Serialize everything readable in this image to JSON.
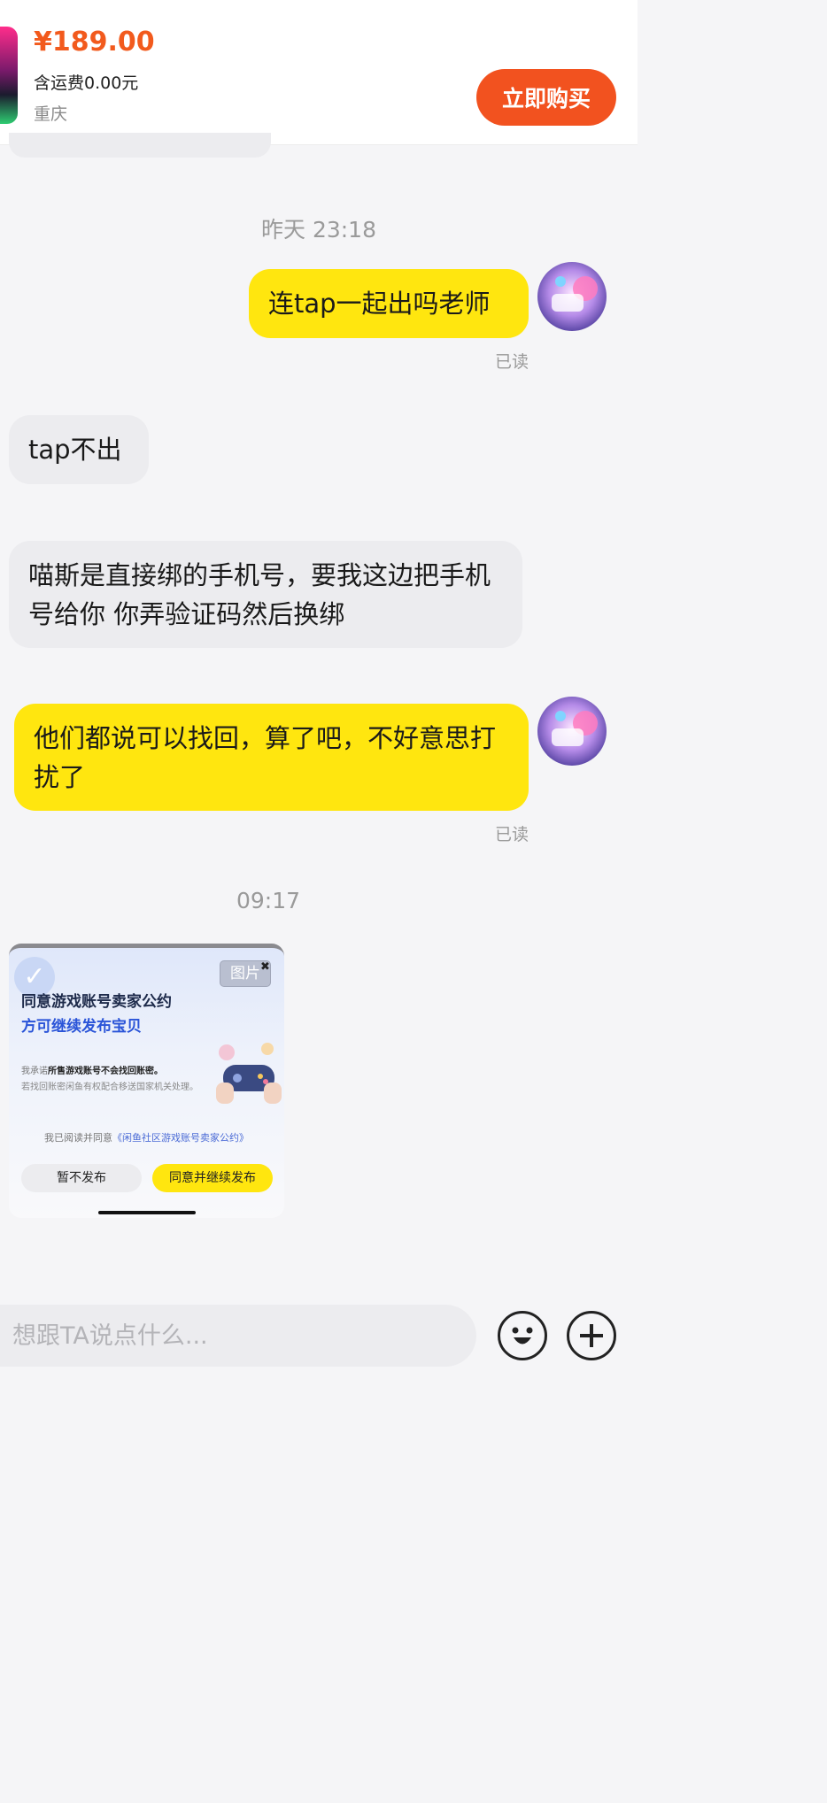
{
  "product": {
    "price": "¥189.00",
    "shipping": "含运费0.00元",
    "location": "重庆",
    "buy_label": "立即购买"
  },
  "messages": [
    {
      "type": "time",
      "text": "昨天 23:18"
    },
    {
      "type": "mine",
      "text": "连tap一起出吗老师",
      "status": "已读"
    },
    {
      "type": "theirs",
      "text": "tap不出"
    },
    {
      "type": "theirs",
      "text": "喵斯是直接绑的手机号，要我这边把手机号给你 你弄验证码然后换绑"
    },
    {
      "type": "mine",
      "text": "他们都说可以找回，算了吧，不好意思打扰了",
      "status": "已读"
    },
    {
      "type": "time",
      "text": "09:17"
    }
  ],
  "image_card": {
    "tag": "图片",
    "title_line1": "同意游戏账号卖家公约",
    "title_line2": "方可继续发布宝贝",
    "pledge_prefix": "我承诺",
    "pledge_bold": "所售游戏账号不会找回账密。",
    "warning": "若找回账密闲鱼有权配合移送国家机关处理。",
    "agree_prefix": "我已阅读并同意",
    "agree_link": "《闲鱼社区游戏账号卖家公约》",
    "decline_label": "暂不发布",
    "accept_label": "同意并继续发布"
  },
  "input": {
    "placeholder": "想跟TA说点什么..."
  },
  "icons": [
    "emoji-icon",
    "plus-icon"
  ],
  "colors": {
    "accent": "#f2521f",
    "mine_bubble": "#ffe60f",
    "theirs_bubble": "#ececef"
  }
}
